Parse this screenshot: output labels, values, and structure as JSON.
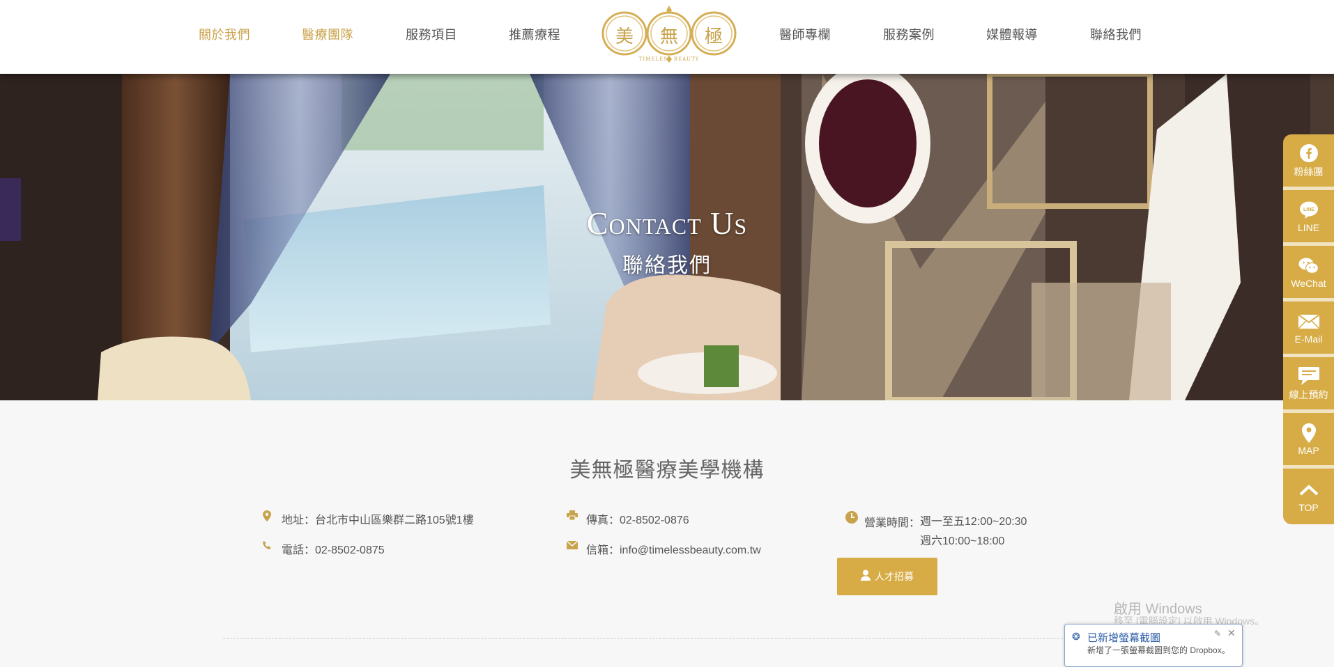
{
  "header": {
    "nav_left": [
      "關於我們",
      "醫療團隊",
      "服務項目",
      "推薦療程"
    ],
    "nav_right": [
      "醫師專欄",
      "服務案例",
      "媒體報導",
      "聯絡我們"
    ],
    "logo": {
      "chars": [
        "美",
        "無",
        "極"
      ],
      "tagline": "TIMELESS BEAUTY"
    }
  },
  "colors": {
    "gold": "#d7ac46",
    "gold_text": "#c9a34c"
  },
  "hero": {
    "title": "Contact Us",
    "subtitle": "聯絡我們"
  },
  "org": {
    "title": "美無極醫療美學機構"
  },
  "contact": {
    "address": "地址：台北市中山區樂群二路105號1樓",
    "phone": "電話：02-8502-0875",
    "fax": "傳真：02-8502-0876",
    "email": "信箱：info@timelessbeauty.com.tw",
    "hours_label": "營業時間：",
    "hours": [
      "週一至五12:00~20:30",
      "週六10:00~18:00"
    ]
  },
  "hire_button": "人才招募",
  "sidebar": [
    {
      "label": "粉絲團",
      "icon": "facebook-icon"
    },
    {
      "label": "LINE",
      "icon": "line-icon"
    },
    {
      "label": "WeChat",
      "icon": "wechat-icon"
    },
    {
      "label": "E-Mail",
      "icon": "mail-icon"
    },
    {
      "label": "線上預約",
      "icon": "chat-bubble-icon"
    },
    {
      "label": "MAP",
      "icon": "map-pin-icon"
    },
    {
      "label": "TOP",
      "icon": "chevron-up-icon"
    }
  ],
  "os": {
    "watermark_title": "啟用 Windows",
    "watermark_text": "移至 [電腦設定] 以啟用 Windows。",
    "toast_title": "已新增螢幕截圖",
    "toast_text": "新增了一張螢幕截圖到您的 Dropbox。"
  }
}
